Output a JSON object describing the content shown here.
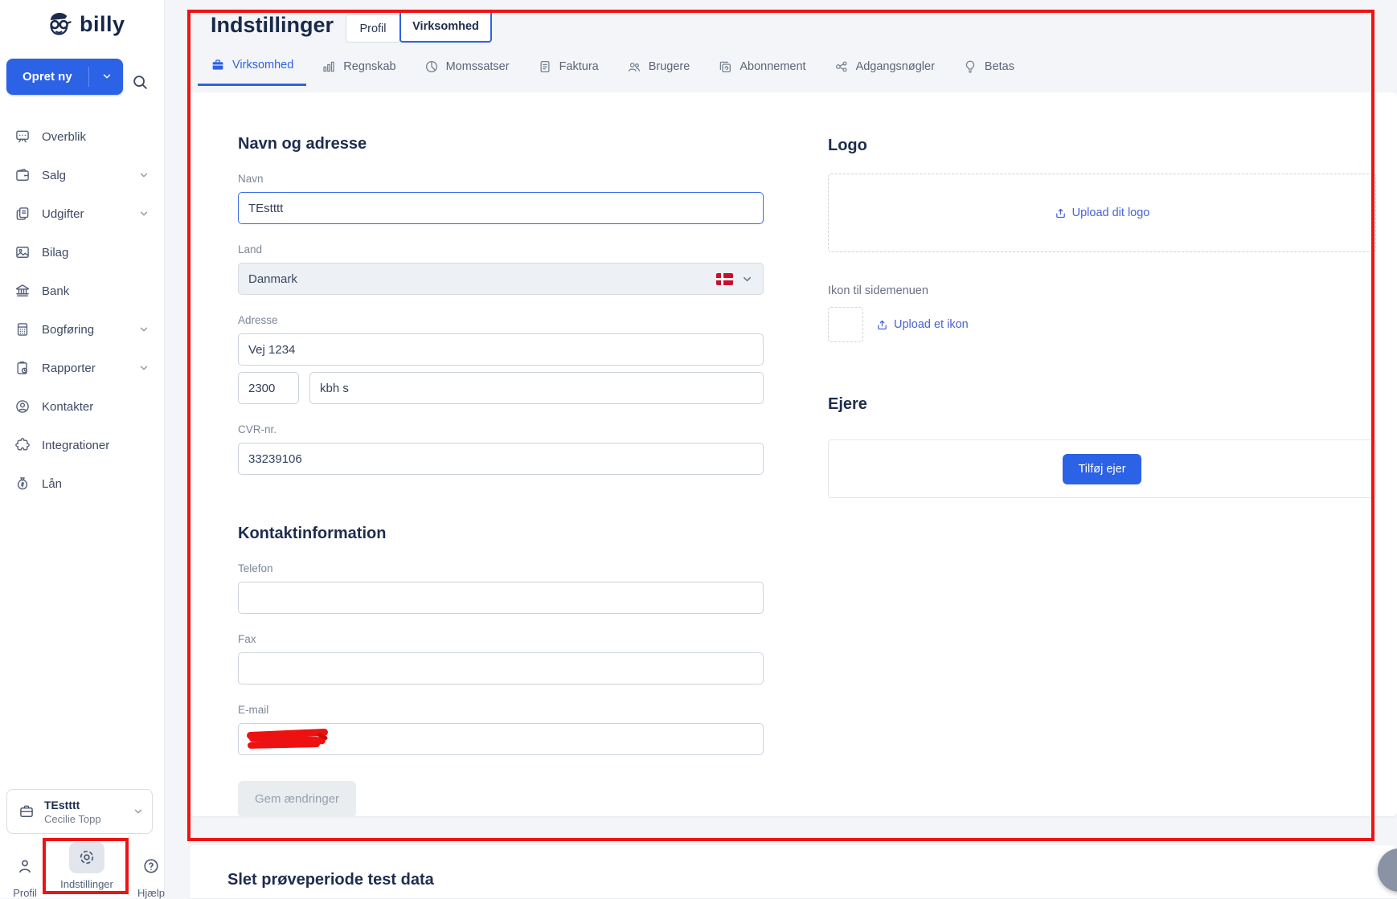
{
  "colors": {
    "accent": "#2c62e6",
    "link_blue": "#4a62d8",
    "annotation_red": "#ef1313",
    "flag_red": "#c8102e",
    "heading_navy": "#1e2c4e"
  },
  "brand": {
    "name": "billy"
  },
  "sidebar": {
    "create_label": "Opret ny",
    "items": [
      {
        "label": "Overblik"
      },
      {
        "label": "Salg"
      },
      {
        "label": "Udgifter"
      },
      {
        "label": "Bilag"
      },
      {
        "label": "Bank"
      },
      {
        "label": "Bogføring"
      },
      {
        "label": "Rapporter"
      },
      {
        "label": "Kontakter"
      },
      {
        "label": "Integrationer"
      },
      {
        "label": "Lån"
      }
    ],
    "company": {
      "name": "TEstttt",
      "user": "Cecilie Topp"
    },
    "footer": {
      "profile": "Profil",
      "settings": "Indstillinger",
      "help": "Hjælp"
    }
  },
  "header": {
    "title": "Indstillinger",
    "scope_profile": "Profil",
    "scope_company": "Virksomhed"
  },
  "tabs": {
    "items": [
      {
        "label": "Virksomhed"
      },
      {
        "label": "Regnskab"
      },
      {
        "label": "Momssatser"
      },
      {
        "label": "Faktura"
      },
      {
        "label": "Brugere"
      },
      {
        "label": "Abonnement"
      },
      {
        "label": "Adgangsnøgler"
      },
      {
        "label": "Betas"
      }
    ]
  },
  "form": {
    "name_address_title": "Navn og adresse",
    "name_label": "Navn",
    "name_value": "TEstttt",
    "country_label": "Land",
    "country_value": "Danmark",
    "address_label": "Adresse",
    "address_value": "Vej 1234",
    "zip_value": "2300",
    "city_value": "kbh s",
    "cvr_label": "CVR-nr.",
    "cvr_value": "33239106",
    "contact_title": "Kontaktinformation",
    "phone_label": "Telefon",
    "fax_label": "Fax",
    "email_label": "E-mail",
    "save_label": "Gem ændringer"
  },
  "panel": {
    "logo_title": "Logo",
    "upload_logo_label": "Upload dit logo",
    "sidebar_icon_label": "Ikon til sidemenuen",
    "upload_icon_label": "Upload et ikon",
    "owners_title": "Ejere",
    "add_owner_label": "Tilføj ejer"
  },
  "bottom": {
    "delete_title": "Slet prøveperiode test data"
  }
}
